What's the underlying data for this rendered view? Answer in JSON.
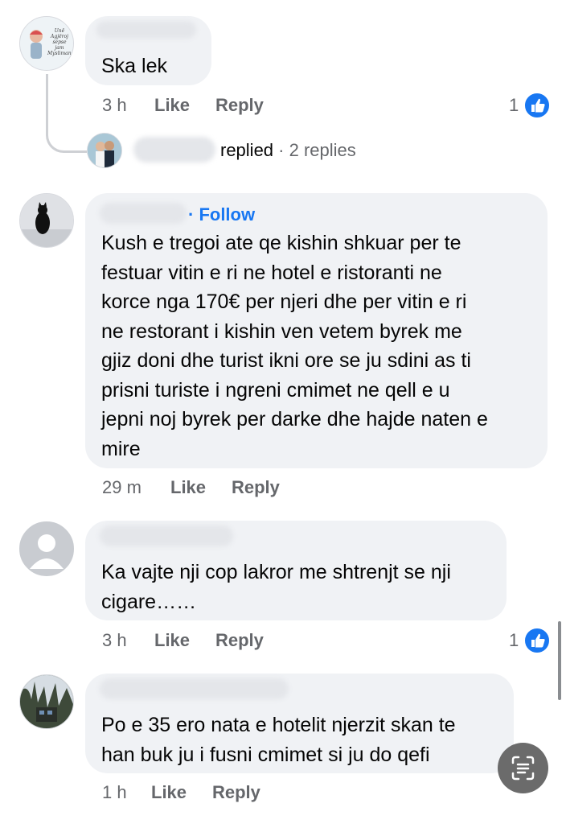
{
  "comments": [
    {
      "text": "Ska lek",
      "time": "3 h",
      "like_label": "Like",
      "reply_label": "Reply",
      "reaction_count": "1",
      "reply_summary": {
        "replied_label": "replied",
        "separator": "·",
        "count_label": "2 replies"
      }
    },
    {
      "follow_label": "· Follow",
      "text_lines": [
        "Kush e tregoi ate qe kishin shkuar per te",
        "festuar vitin e ri ne hotel e ristoranti  ne",
        "korce nga 170€ per njeri dhe per vitin e ri",
        "ne restorant i kishin ven vetem byrek me",
        "gjiz doni dhe turist ikni ore se ju sdini as ti",
        "prisni turiste i ngreni cmimet ne qell e u",
        "jepni noj byrek per darke dhe hajde naten e",
        "mire"
      ],
      "time": "29 m",
      "like_label": "Like",
      "reply_label": "Reply"
    },
    {
      "text_lines": [
        "Ka vajte nji cop lakror me shtrenjt se nji",
        "cigare……"
      ],
      "time": "3 h",
      "like_label": "Like",
      "reply_label": "Reply",
      "reaction_count": "1"
    },
    {
      "text_lines": [
        "Po e 35 ero nata e hotelit njerzit skan te",
        "han buk ju i fusni cmimet si ju do qefi"
      ],
      "time": "1 h",
      "like_label": "Like",
      "reply_label": "Reply"
    }
  ],
  "avatar1_text": [
    "Unë Agjëroj",
    "sepse jam",
    "Mysliman."
  ],
  "colors": {
    "accent": "#1877f2",
    "bubble": "#f0f2f5",
    "meta": "#65676b"
  },
  "icons": {
    "like": "thumbs-up-icon",
    "scan": "text-scan-icon"
  }
}
